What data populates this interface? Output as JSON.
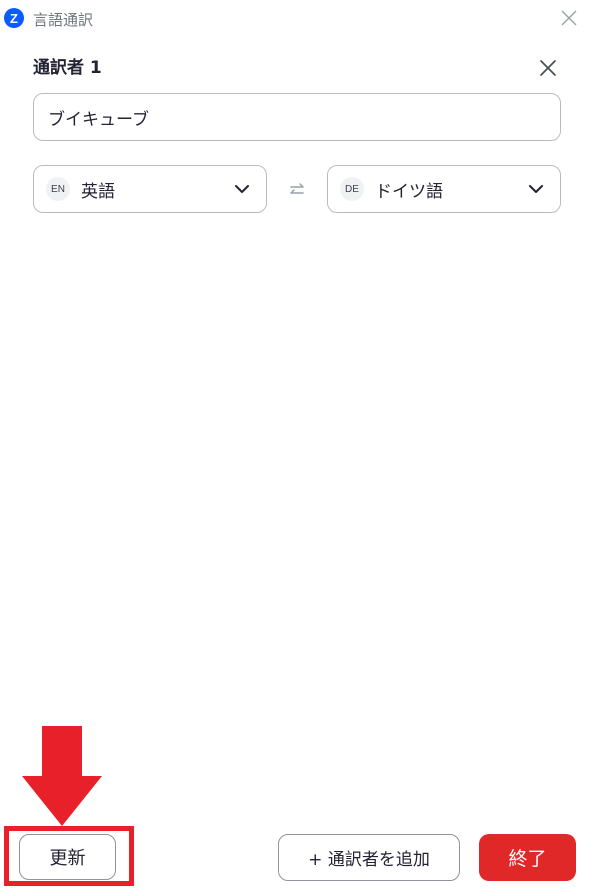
{
  "window": {
    "title": "言語通訳",
    "logo_letter": "Z"
  },
  "interpreter": {
    "heading": "通訳者 1",
    "name_value": "ブイキューブ"
  },
  "languages": {
    "source": {
      "code": "EN",
      "name": "英語"
    },
    "target": {
      "code": "DE",
      "name": "ドイツ語"
    }
  },
  "footer": {
    "update_label": "更新",
    "add_label": "+ 通訳者を追加",
    "end_label": "終了"
  },
  "colors": {
    "accent_red": "#e02828",
    "highlight_red": "#e8202a",
    "logo_blue": "#0b5cff"
  }
}
